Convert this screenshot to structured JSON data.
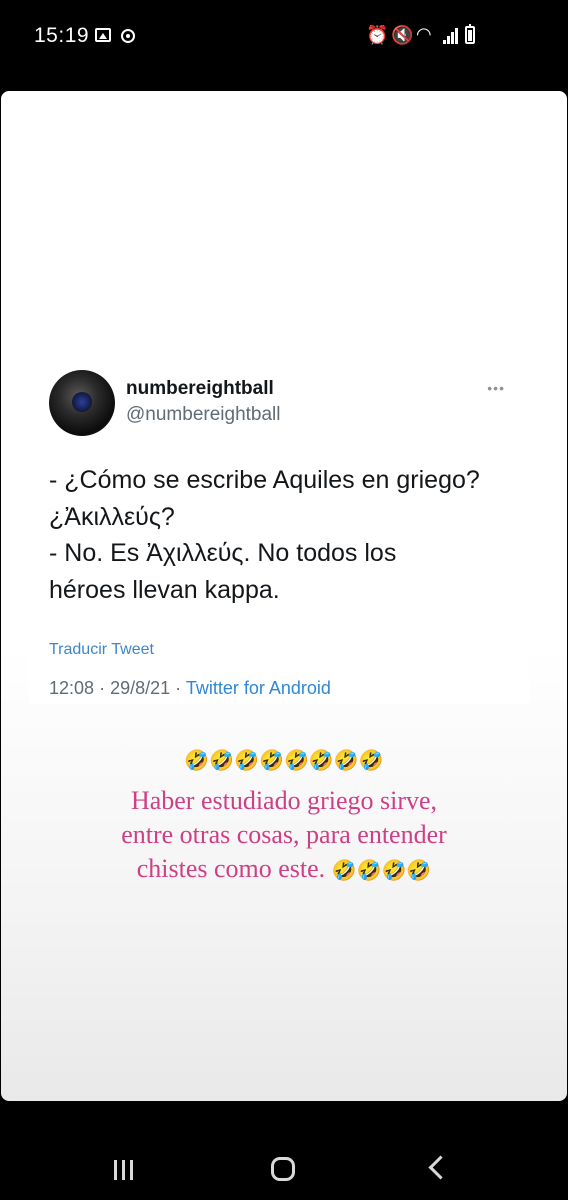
{
  "status_bar": {
    "time": "15:19",
    "icons": [
      "image-icon",
      "record-icon",
      "alarm-icon",
      "mute-icon",
      "wifi-icon",
      "signal-icon",
      "battery-icon"
    ]
  },
  "tweet": {
    "display_name": "numbereightball",
    "handle": "@numbereightball",
    "text_lines": [
      "- ¿Cómo se escribe Aquiles en griego?",
      "¿Ἀκιλλεύς?",
      "- No. Es Ἀχιλλεύς. No todos los",
      "héroes llevan kappa."
    ],
    "translate_label": "Traducir Tweet",
    "time": "12:08",
    "date": "29/8/21",
    "separator": "·",
    "source": "Twitter for Android"
  },
  "caption": {
    "emoji_row": "🤣🤣🤣🤣🤣🤣🤣🤣",
    "line1": "Haber estudiado griego sirve,",
    "line2": "entre otras cosas, para entender",
    "line3": "chistes como este.",
    "line3_emoji": "🤣🤣🤣🤣"
  },
  "nav_bar": {
    "buttons": [
      "recent-apps",
      "home",
      "back"
    ]
  },
  "colors": {
    "caption": "#cf3f86",
    "link": "#3f86c6",
    "source": "#2f87d8",
    "muted": "#5f6b75"
  }
}
